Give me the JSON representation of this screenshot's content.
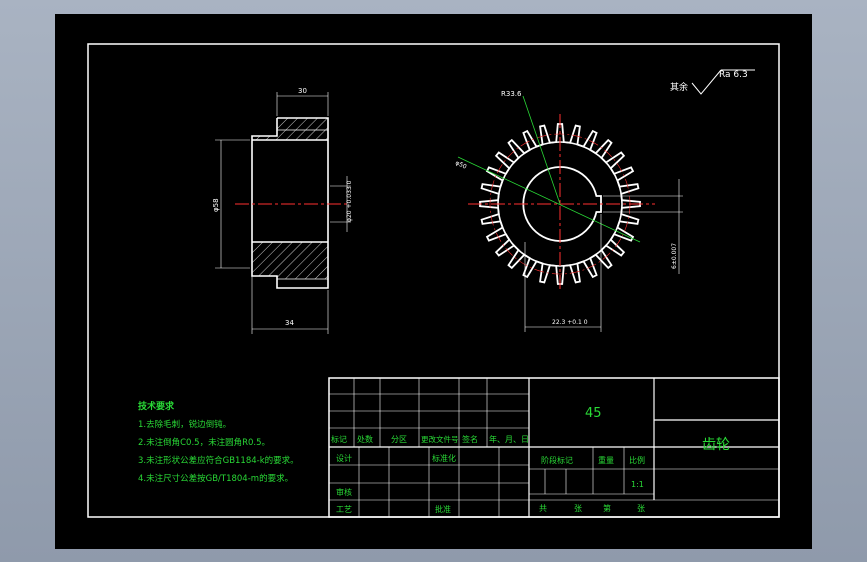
{
  "drawing": {
    "roughness_label": "其余",
    "roughness_value": "Ra 6.3",
    "side_view": {
      "width_dim": "30",
      "length_dim": "34",
      "outer_dia": "φ58",
      "bore_dia": "φ20 +0.033 0"
    },
    "front_view": {
      "tip_dia": "R33.6",
      "pitch_dia": "φ50",
      "keyway_depth": "22.3 +0.1 0",
      "keyway_width": "6±0.007"
    },
    "tech_requirements": {
      "title": "技术要求",
      "items": [
        "1.去除毛刺，锐边倒钝。",
        "2.未注倒角C0.5，未注圆角R0.5。",
        "3.未注形状公差应符合GB1184-k的要求。",
        "4.未注尺寸公差按GB/T1804-m的要求。"
      ]
    }
  },
  "title_block": {
    "material": "45",
    "part_name": "齿轮",
    "headers": [
      "标记",
      "处数",
      "分区",
      "更改文件号",
      "签名",
      "年、月、日"
    ],
    "design": "设计",
    "standardize": "标准化",
    "check": "审核",
    "process": "工艺",
    "approve": "批准",
    "stage_mark": "阶段标记",
    "weight": "重量",
    "scale": "比例",
    "scale_value": "1:1",
    "total_sheets": "共",
    "sheets_unit": "张",
    "sheet_no": "第",
    "sheet_unit": "张"
  }
}
